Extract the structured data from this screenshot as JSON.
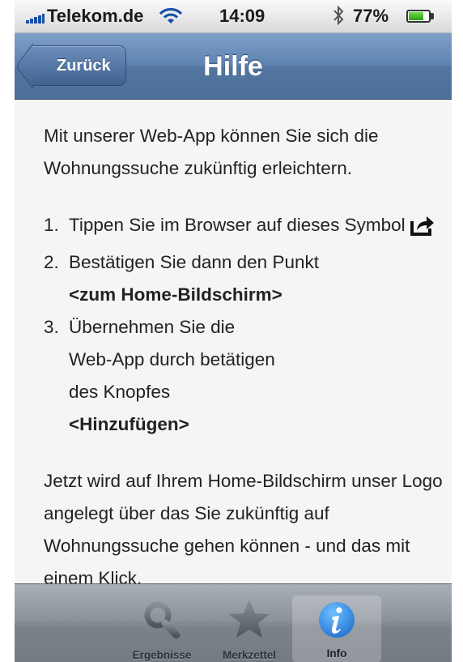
{
  "status_bar": {
    "carrier": "Telekom.de",
    "time": "14:09",
    "battery_percent": "77%",
    "battery_level": 0.77
  },
  "nav_bar": {
    "back_label": "Zurück",
    "title": "Hilfe"
  },
  "content": {
    "intro": "Mit unserer Web-App können Sie sich die Wohnungssuche zukünftig erleichtern.",
    "steps": [
      {
        "number": "1.",
        "text": "Tippen Sie im Browser auf dieses Symbol",
        "icon": "share-icon"
      },
      {
        "number": "2.",
        "text": "Bestätigen Sie dann den Punkt",
        "bold": "<zum Home-Bildschirm>"
      },
      {
        "number": "3.",
        "text": "Übernehmen Sie die Web-App durch betätigen des Knopfes",
        "bold": "<Hinzufügen>"
      }
    ],
    "outro": "Jetzt wird auf Ihrem Home-Bildschirm unser Logo angelegt über das Sie zukünftig auf Wohnungssuche gehen können - und das mit einem Klick."
  },
  "tab_bar": {
    "tabs": [
      {
        "label": "Ergebnisse",
        "icon": "search-icon",
        "active": false
      },
      {
        "label": "Merkzettel",
        "icon": "star-icon",
        "active": false
      },
      {
        "label": "Info",
        "icon": "info-icon",
        "active": true
      }
    ]
  },
  "colors": {
    "nav_bar": "#5f83b2",
    "tab_bar": "#8c939b",
    "info_icon": "#1f7fe0",
    "text": "#222222"
  }
}
